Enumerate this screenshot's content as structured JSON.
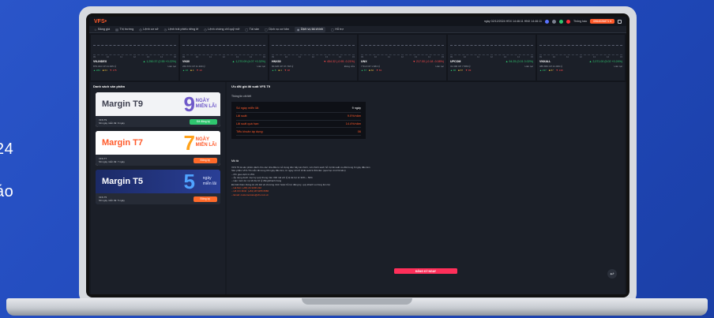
{
  "background": {
    "text1": "24",
    "text2": "áo"
  },
  "app": {
    "logo_main": "VFS",
    "logo_accent": "•",
    "time_info": "ngày 02/12/2024 HSX 14:46:11 HNX 14:46:11",
    "notify": "Thông báo",
    "account": "0964026871 ▾"
  },
  "nav": [
    {
      "icon": "☆",
      "label": "Bảng giá"
    },
    {
      "icon": "▤",
      "label": "Thị trường"
    },
    {
      "icon": "◎",
      "label": "Lệnh cơ sở"
    },
    {
      "icon": "◷",
      "label": "Lệnh trái phiếu riêng lẻ"
    },
    {
      "icon": "◷",
      "label": "Lệnh chứng chỉ quỹ mở"
    },
    {
      "icon": "▢",
      "label": "Tài sản"
    },
    {
      "icon": "▢",
      "label": "Dịch vụ cơ bản"
    },
    {
      "icon": "◉",
      "label": "Dịch vụ tài chính"
    },
    {
      "icon": "▢",
      "label": "Hỗ trợ"
    }
  ],
  "indices": [
    {
      "name": "VN-INDEX",
      "chg": "▲ 1,250.37 (2.55 +0.22%)",
      "dir": "up",
      "vol": "879.434 CP 21.005 tỷ",
      "status": "Liên tục",
      "up": "▲ 284",
      "ref": "■ 64",
      "down": "▼ 175"
    },
    {
      "name": "VN30",
      "chg": "▲ 1,270.09 (4.07 +0.32%)",
      "dir": "up",
      "vol": "260.674 CP 11.309 tỷ",
      "status": "Liên tục",
      "up": "▲ 16",
      "ref": "■ 4",
      "down": "▼ 10"
    },
    {
      "name": "HNX30",
      "chg": "▼ 454.32 (-0.95 -0.21%)",
      "dir": "down",
      "vol": "90.026 CP 97.748 tỷ",
      "status": "Đóng cửa",
      "up": "▲ 8",
      "ref": "■ 4",
      "down": "▼ 18"
    },
    {
      "name": "UNX",
      "chg": "▼ 217.00 (-0.18 -0.08%)",
      "dir": "down",
      "vol": "7.513 CP 1.684 tỷ",
      "status": "Liên tục",
      "up": "▲ 67",
      "ref": "■ 60",
      "down": "▼ 81"
    },
    {
      "name": "UPCOM",
      "chg": "▲ 94.25 (0.01 0.02%)",
      "dir": "up",
      "vol": "31.396 CP 7.589 tỷ",
      "status": "Liên tục",
      "up": "▲ 96",
      "ref": "■ 87",
      "down": "▼ 99"
    },
    {
      "name": "VNXALL",
      "chg": "▲ 2,071.00 (5.02 +0.24%)",
      "dir": "up",
      "vol": "385.656 CP 21.009 tỷ",
      "status": "Liên tục",
      "up": "▲ 237",
      "ref": "■ 87",
      "down": "▼ 139"
    }
  ],
  "ticks": [
    "09",
    "10",
    "11",
    "12",
    "13",
    "14",
    "15"
  ],
  "left": {
    "title": "Danh sách sản phẩm",
    "cards": [
      {
        "title": "Margin T9",
        "big": "9",
        "side1": "NGÀY",
        "side2": "MIỄN LÃI",
        "meta1": "VFS T9",
        "meta2": "Số ngày miễn lãi: 9 ngày",
        "button": "Đã đăng ký",
        "btn_class": "green"
      },
      {
        "title": "Margin T7",
        "big": "7",
        "side1": "NGÀY",
        "side2": "MIỄN LÃI",
        "meta1": "VFS T7",
        "meta2": "Số ngày miễn lãi: 7 ngày",
        "button": "Đăng ký",
        "btn_class": "orange"
      },
      {
        "title": "Margin T5",
        "big": "5",
        "side1": "ngày",
        "side2": "miễn lãi",
        "meta1": "VFS T5",
        "meta2": "Số ngày miễn lãi: 5 ngày",
        "button": "Đăng ký",
        "btn_class": "orange"
      }
    ]
  },
  "right": {
    "title": "Ưu đãi giá lãi suất VFS T9",
    "sub": "Thông tin chi tiết",
    "rows": [
      {
        "label": "Số ngày miễn lãi:",
        "value": "9 ngày"
      },
      {
        "label": "Lãi suất:",
        "value": "9.0%/năm"
      },
      {
        "label": "Lãi suất quá hạn:",
        "value": "14.4%/năm"
      },
      {
        "label": "Tiểu khoản áp dụng:",
        "value": "06"
      }
    ],
    "desc_title": "Mô tả",
    "desc": [
      "VFS T9 là sản phẩm dành cho các nhà đầu tư sử dụng đòn bẩy tài chính, với chính sách hỗ trợ lãi suất ưu đãi trong 9 ngày đầu tiên",
      "Sản phẩm VFS T9 miễn lãi trong 09 ngày đầu tiên, từ ngày 10 trở đi lãi suất 9.0%/năm (quá hạn 14.4%/năm)",
      "– Phí giao dịch 0.15%",
      "– Áp dụng danh mục ký quỹ chung trên 300 mã với tỷ lệ tài trợ từ 30% – 50%",
      "– Hạn mức dư nợ tối đa 10 tỷ đồng/khách hàng",
      "Để biết thêm thông tin chi tiết về chương trình hoặc hỗ trợ đăng ký, quý khách vui lòng liên hệ:",
      "– Hà Nội: (+84) 24 3200 222",
      "– Hồ Chí Minh: (+84) 28 6255 6586",
      "– Email: customercare@vfs.com.vn"
    ],
    "register": "ĐĂNG KÝ NGAY",
    "fab": "↩"
  }
}
